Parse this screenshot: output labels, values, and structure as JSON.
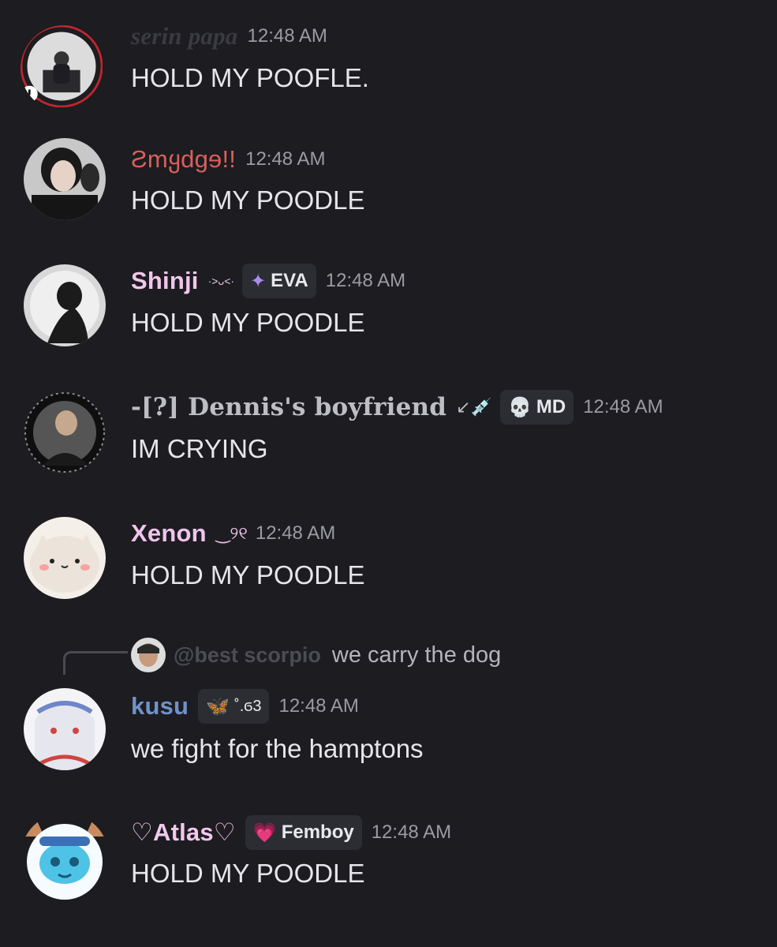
{
  "messages": [
    {
      "user": "serin papa",
      "time": "12:48 AM",
      "text": "HOLD MY POOFLE.",
      "name_color": "#3a3a42"
    },
    {
      "user": "Ƨmყdgɘ!!",
      "time": "12:48 AM",
      "text": "HOLD MY POODLE",
      "name_color": "#d9605a"
    },
    {
      "user": "Shinji",
      "deco": "·˃ᴗ˂·",
      "tag": {
        "icon": "✦",
        "label": "EVA"
      },
      "time": "12:48 AM",
      "text": "HOLD MY POODLE",
      "name_color": "#f2c6ea"
    },
    {
      "user": "-[?] Dennis's boyfriend",
      "deco": "↙💉",
      "tag": {
        "icon": "💀",
        "label": "MD"
      },
      "time": "12:48 AM",
      "text": "IM CRYING",
      "name_color": "#bdbdc4"
    },
    {
      "user": "Xenon",
      "deco": "‿୨୧",
      "time": "12:48 AM",
      "text": "HOLD MY POODLE",
      "name_color": "#f0c4ec"
    },
    {
      "user": "kusu",
      "tag": {
        "icon": "🦋",
        "label": "˚.ϭ3"
      },
      "time": "12:48 AM",
      "text": "we fight for the hamptons",
      "name_color": "#6f93c9",
      "reply": {
        "user": "@best scorpio",
        "text": "we carry the dog"
      }
    },
    {
      "user": "♡Atlas♡",
      "tag": {
        "icon": "💗",
        "label": "Femboy"
      },
      "time": "12:48 AM",
      "text": "HOLD MY POODLE",
      "name_color": "#f3c8ee"
    }
  ]
}
